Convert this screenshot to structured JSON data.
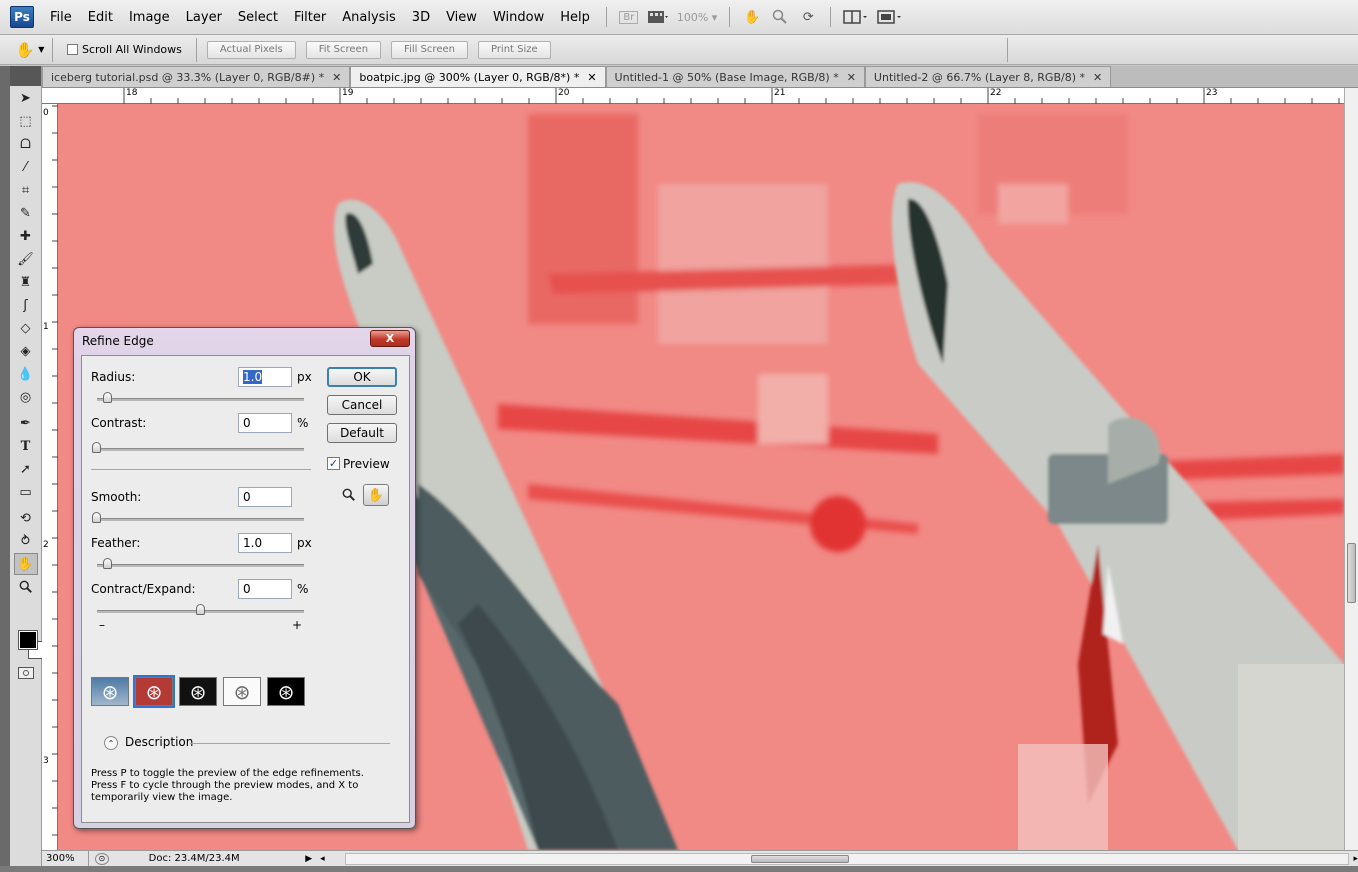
{
  "menubar": {
    "logo": "Ps",
    "items": [
      "File",
      "Edit",
      "Image",
      "Layer",
      "Select",
      "Filter",
      "Analysis",
      "3D",
      "View",
      "Window",
      "Help"
    ],
    "bridge_label": "Br",
    "zoom_display": "100%"
  },
  "options_bar": {
    "scroll_all_windows_label": "Scroll All Windows",
    "scroll_all_windows_checked": false,
    "buttons": [
      "Actual Pixels",
      "Fit Screen",
      "Fill Screen",
      "Print Size"
    ]
  },
  "tabs": [
    {
      "label": "iceberg tutorial.psd @ 33.3% (Layer 0, RGB/8#) *",
      "active": false
    },
    {
      "label": "boatpic.jpg @ 300% (Layer 0, RGB/8*) *",
      "active": true
    },
    {
      "label": "Untitled-1 @ 50% (Base Image, RGB/8) *",
      "active": false
    },
    {
      "label": "Untitled-2 @ 66.7% (Layer 8, RGB/8) *",
      "active": false
    }
  ],
  "ruler": {
    "top_labels": [
      "18",
      "19",
      "20",
      "21",
      "22",
      "23"
    ],
    "left_labels": [
      "0",
      "1",
      "2",
      "3"
    ]
  },
  "status": {
    "zoom": "300%",
    "doc_info": "Doc: 23.4M/23.4M"
  },
  "dialog": {
    "title": "Refine Edge",
    "close_label": "X",
    "fields": {
      "radius": {
        "label": "Radius:",
        "value": "1.0",
        "unit": "px"
      },
      "contrast": {
        "label": "Contrast:",
        "value": "0",
        "unit": "%"
      },
      "smooth": {
        "label": "Smooth:",
        "value": "0",
        "unit": ""
      },
      "feather": {
        "label": "Feather:",
        "value": "1.0",
        "unit": "px"
      },
      "contract_expand": {
        "label": "Contract/Expand:",
        "value": "0",
        "unit": "%"
      }
    },
    "minus_label": "–",
    "plus_label": "+",
    "buttons": {
      "ok": "OK",
      "cancel": "Cancel",
      "default": "Default"
    },
    "preview": {
      "label": "Preview",
      "checked": true
    },
    "view_modes_selected_index": 1,
    "description": {
      "label": "Description",
      "text": "Press P to toggle the preview of the edge refinements. Press F to cycle through the preview modes, and X to temporarily view the image."
    }
  },
  "colors": {
    "mask_overlay": "#f08a86",
    "accent_blue": "#3468c8",
    "close_red": "#c0392b"
  }
}
